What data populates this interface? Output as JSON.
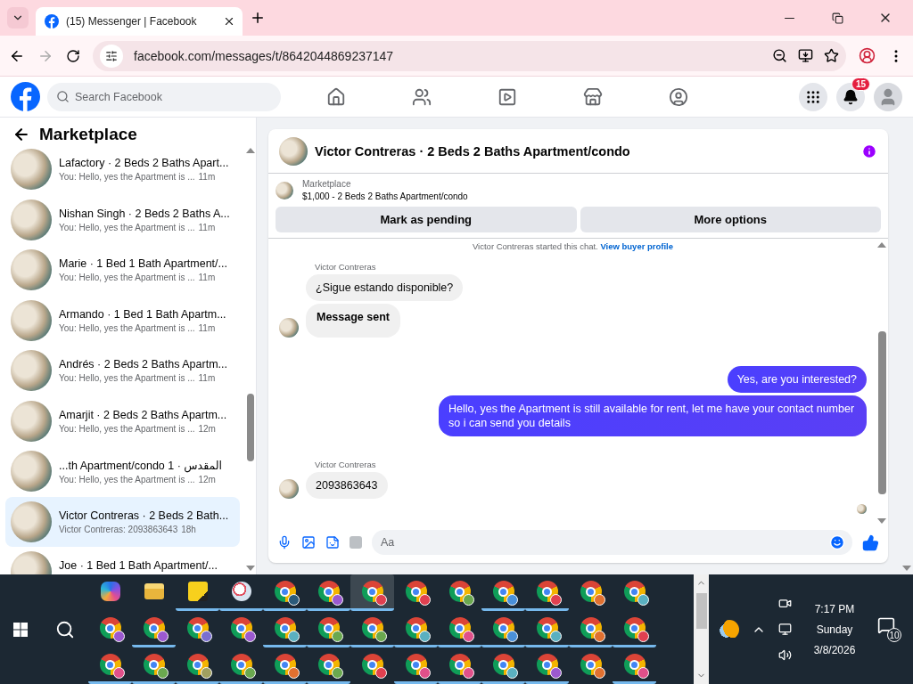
{
  "browser": {
    "tab_title": "(15) Messenger | Facebook",
    "address": "facebook.com/messages/t/8642044869237147"
  },
  "facebook_nav": {
    "search_placeholder": "Search Facebook",
    "notification_count": "15"
  },
  "sidebar": {
    "title": "Marketplace",
    "conversations": [
      {
        "title": "Lafactory · 2 Beds 2 Baths Apart...",
        "preview": "You: Hello, yes the Apartment is ...",
        "time": "11m",
        "selected": false
      },
      {
        "title": "Nishan Singh · 2 Beds 2 Baths A...",
        "preview": "You: Hello, yes the Apartment is ...",
        "time": "11m",
        "selected": false
      },
      {
        "title": "Marie · 1 Bed 1 Bath Apartment/...",
        "preview": "You: Hello, yes the Apartment is ...",
        "time": "11m",
        "selected": false
      },
      {
        "title": "Armando · 1 Bed 1 Bath Apartm...",
        "preview": "You: Hello, yes the Apartment is ...",
        "time": "11m",
        "selected": false
      },
      {
        "title": "Andrés · 2 Beds 2 Baths Apartm...",
        "preview": "You: Hello, yes the Apartment is ...",
        "time": "11m",
        "selected": false
      },
      {
        "title": "Amarjit · 2 Beds 2 Baths Apartm...",
        "preview": "You: Hello, yes the Apartment is ...",
        "time": "12m",
        "selected": false
      },
      {
        "title": "...th Apartment/condo 1 · المقدس",
        "preview": "You: Hello, yes the Apartment is ...",
        "time": "12m",
        "selected": false
      },
      {
        "title": "Victor Contreras · 2 Beds 2 Bath...",
        "preview": "Victor Contreras: 2093863643",
        "time": "18h",
        "selected": true
      },
      {
        "title": "Joe · 1 Bed 1 Bath Apartment/...",
        "selected": false
      }
    ]
  },
  "chat": {
    "title": "Victor Contreras · 2 Beds 2 Baths Apartment/condo",
    "listing": {
      "label": "Marketplace",
      "detail": "$1,000 - 2 Beds 2 Baths Apartment/condo"
    },
    "buttons": [
      "Mark as pending",
      "More options"
    ],
    "system_note": {
      "text": "Victor Contreras started this chat.",
      "link": "View buyer profile"
    },
    "groups": [
      {
        "kind": "incoming",
        "sender": "Victor Contreras",
        "bubbles": [
          {
            "kind": "text",
            "text": "¿Sigue estando disponible?"
          },
          {
            "kind": "notice",
            "text": "Message sent"
          }
        ]
      },
      {
        "kind": "outgoing",
        "bubbles": [
          {
            "kind": "text",
            "text": "Yes, are you interested?"
          },
          {
            "kind": "text",
            "text": "Hello, yes the Apartment is still available for rent, let me have your contact number so i can send you details"
          }
        ]
      },
      {
        "kind": "incoming",
        "sender": "Victor Contreras",
        "bubbles": [
          {
            "kind": "text",
            "text": "2093863643"
          }
        ]
      }
    ],
    "composer_placeholder": "Aa"
  },
  "taskbar": {
    "apps": [
      {
        "kind": "copilot",
        "open": false,
        "selected": false
      },
      {
        "kind": "files",
        "open": false,
        "selected": false
      },
      {
        "kind": "notes",
        "open": true,
        "selected": false
      },
      {
        "kind": "paint",
        "open": true,
        "selected": false
      },
      {
        "kind": "browser",
        "color": "#2b5b7a",
        "open": true,
        "selected": false
      },
      {
        "kind": "browser",
        "color": "#9b59d0",
        "open": true,
        "selected": false
      },
      {
        "kind": "browser",
        "color": "#e04050",
        "open": true,
        "selected": true
      },
      {
        "kind": "browser",
        "color": "#e04050",
        "open": false,
        "selected": false
      },
      {
        "kind": "browser",
        "color": "#6aa84f",
        "open": false,
        "selected": false
      },
      {
        "kind": "browser",
        "color": "#4a90d9",
        "open": true,
        "selected": false
      },
      {
        "kind": "browser",
        "color": "#e04050",
        "open": true,
        "selected": false
      },
      {
        "kind": "browser",
        "color": "#e07030",
        "open": false,
        "selected": false
      },
      {
        "kind": "browser",
        "color": "#5ab0c0",
        "open": false,
        "selected": false
      },
      {
        "kind": "browser",
        "color": "#9b59d0",
        "open": false,
        "selected": false
      },
      {
        "kind": "browser",
        "color": "#9b59d0",
        "open": true,
        "selected": false
      },
      {
        "kind": "browser",
        "color": "#7a6fd0",
        "open": false,
        "selected": false
      },
      {
        "kind": "browser",
        "color": "#9b59d0",
        "open": false,
        "selected": false
      },
      {
        "kind": "browser",
        "color": "#5ab0c0",
        "open": true,
        "selected": false
      },
      {
        "kind": "browser",
        "color": "#6aa84f",
        "open": true,
        "selected": false
      },
      {
        "kind": "browser",
        "color": "#6aa84f",
        "open": true,
        "selected": false
      },
      {
        "kind": "browser",
        "color": "#5ab0c0",
        "open": true,
        "selected": false
      },
      {
        "kind": "browser",
        "color": "#e0508a",
        "open": true,
        "selected": false
      },
      {
        "kind": "browser",
        "color": "#4a90d9",
        "open": true,
        "selected": false
      },
      {
        "kind": "browser",
        "color": "#5ab0c0",
        "open": true,
        "selected": false
      },
      {
        "kind": "browser",
        "color": "#e07030",
        "open": true,
        "selected": false
      },
      {
        "kind": "browser",
        "color": "#e04050",
        "open": true,
        "selected": false
      },
      {
        "kind": "browser",
        "color": "#e0508a",
        "open": true,
        "selected": false
      },
      {
        "kind": "browser",
        "color": "#6aa84f",
        "open": true,
        "selected": false
      },
      {
        "kind": "browser",
        "color": "#a0a060",
        "open": true,
        "selected": false
      },
      {
        "kind": "browser",
        "color": "#6aa84f",
        "open": true,
        "selected": false
      },
      {
        "kind": "browser",
        "color": "#e07030",
        "open": true,
        "selected": false
      },
      {
        "kind": "browser",
        "color": "#6aa84f",
        "open": true,
        "selected": false
      },
      {
        "kind": "browser",
        "color": "#e04050",
        "open": false,
        "selected": false
      },
      {
        "kind": "browser",
        "color": "#e0508a",
        "open": true,
        "selected": false
      },
      {
        "kind": "browser",
        "color": "#e0508a",
        "open": true,
        "selected": false
      },
      {
        "kind": "browser",
        "color": "#5ab0c0",
        "open": true,
        "selected": false
      },
      {
        "kind": "browser",
        "color": "#9b59d0",
        "open": true,
        "selected": false
      },
      {
        "kind": "browser",
        "color": "#e07030",
        "open": false,
        "selected": false
      },
      {
        "kind": "browser",
        "color": "#e0508a",
        "open": true,
        "selected": false
      }
    ],
    "time": "7:17 PM",
    "day": "Sunday",
    "date": "3/8/2026",
    "notification_count": "10"
  }
}
